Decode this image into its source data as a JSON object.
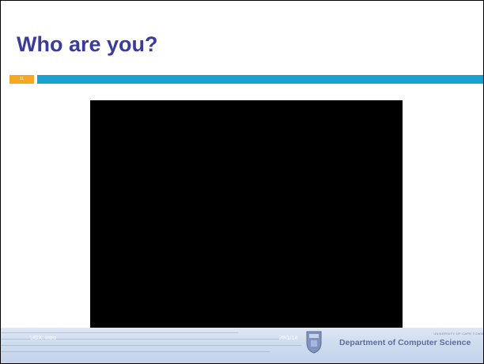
{
  "slide": {
    "title": "Who are you?",
    "slide_number": "11"
  },
  "footer": {
    "course": "UGX: Intro",
    "date": "28/1/14",
    "university": "UNIVERSITY OF CAPE TOWN",
    "department": "Department of Computer Science"
  },
  "colors": {
    "title": "#3b3b9a",
    "accent_orange": "#f5a623",
    "accent_blue": "#1aa0d0",
    "video_background": "#000000"
  }
}
